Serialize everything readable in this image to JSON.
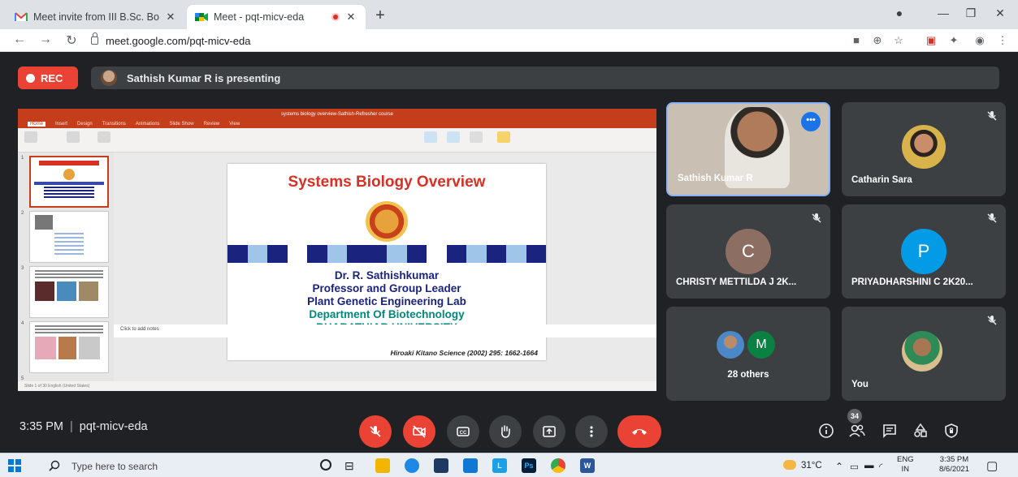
{
  "browser": {
    "tabs": [
      {
        "title": "Meet invite from III B.Sc. Botany",
        "icon": "gmail-icon",
        "active": false
      },
      {
        "title": "Meet - pqt-micv-eda",
        "icon": "meet-icon",
        "active": true
      }
    ],
    "url": "meet.google.com/pqt-micv-eda"
  },
  "meet": {
    "rec_label": "REC",
    "presenting_text": "Sathish Kumar R is presenting",
    "presentation": {
      "window_title": "systems biology overview-Sathish-Refresher course",
      "ribbon_tabs": [
        "Home",
        "Insert",
        "Design",
        "Transitions",
        "Animations",
        "Slide Show",
        "Review",
        "View"
      ],
      "slide": {
        "title": "Systems Biology Overview",
        "lines": [
          "Dr. R. Sathishkumar",
          "Professor and Group Leader",
          "Plant Genetic Engineering Lab",
          "Department Of Biotechnology",
          "BHARATHIAR UNIVERSITY"
        ],
        "citation": "Hiroaki Kitano Science (2002) 295: 1662-1664"
      },
      "notes_placeholder": "Click to add notes",
      "status_text": "Slide 1 of 30    English (United States)",
      "thumb_numbers": [
        "1",
        "2",
        "3",
        "4",
        "5"
      ]
    },
    "participants": [
      {
        "name": "Sathish Kumar R",
        "type": "video"
      },
      {
        "name": "Catharin Sara",
        "type": "photo",
        "muted": true
      },
      {
        "name": "CHRISTY METTILDA J 2K...",
        "letter": "C",
        "color": "#8d6e63",
        "muted": true
      },
      {
        "name": "PRIYADHARSHINI C 2K20...",
        "letter": "P",
        "color": "#039be5",
        "muted": true
      },
      {
        "name": "28 others",
        "letter": "M",
        "color": "#0b8043"
      },
      {
        "name": "You",
        "type": "photo",
        "muted": true
      }
    ],
    "more_label": "•••",
    "time": "3:35 PM",
    "meeting_code": "pqt-micv-eda",
    "participant_count": "34"
  },
  "taskbar": {
    "search_placeholder": "Type here to search",
    "weather": "31°C",
    "language": "ENG",
    "region": "IN",
    "time": "3:35 PM",
    "date": "8/6/2021"
  }
}
